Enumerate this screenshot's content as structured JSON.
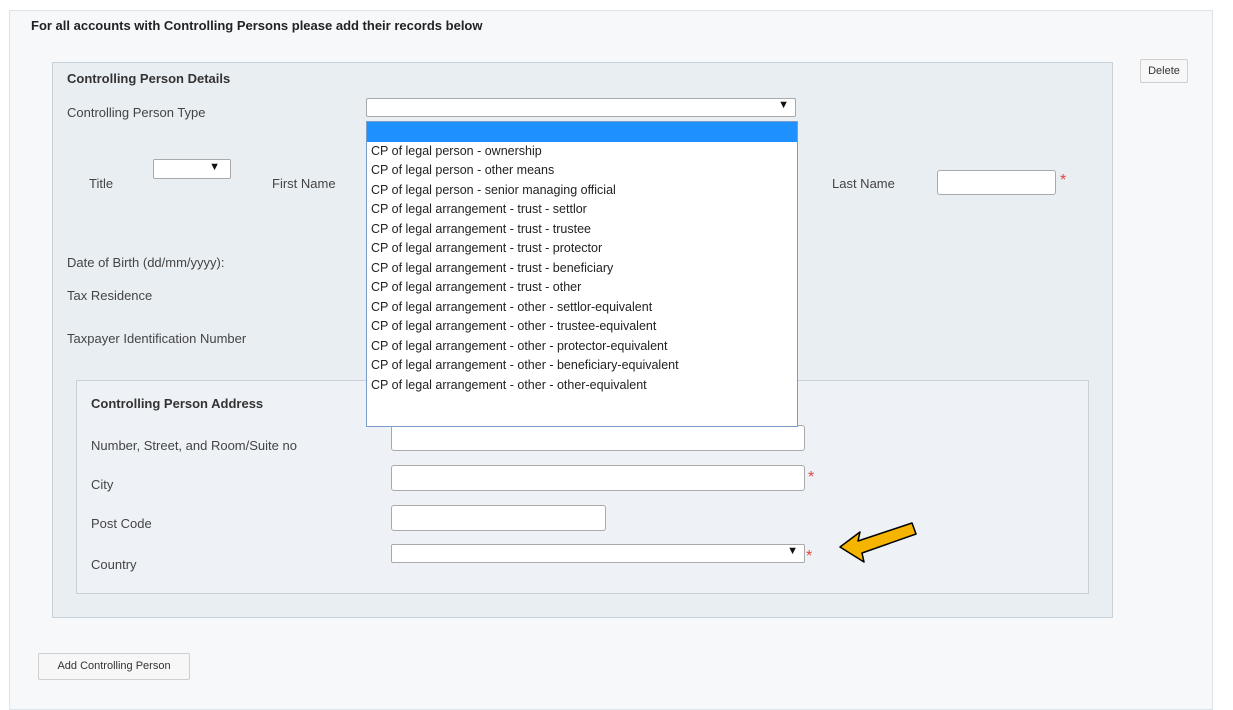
{
  "page": {
    "heading": "For all accounts with Controlling Persons please add their records below",
    "delete_label": "Delete",
    "add_label": "Add Controlling Person"
  },
  "details": {
    "section_title": "Controlling Person Details",
    "type_label": "Controlling Person Type",
    "type_value": "",
    "title_label": "Title",
    "first_name_label": "First Name",
    "last_name_label": "Last Name",
    "dob_label": "Date of Birth (dd/mm/yyyy):",
    "tax_residence_label": "Tax Residence",
    "tin_label": "Taxpayer Identification Number",
    "required_mark": "*"
  },
  "address": {
    "section_title": "Controlling Person Address",
    "street_label": "Number, Street, and Room/Suite no",
    "city_label": "City",
    "postcode_label": "Post Code",
    "country_label": "Country",
    "required_mark": "*"
  },
  "dropdown": {
    "options": [
      "",
      "CP of legal person - ownership",
      "CP of legal person - other means",
      "CP of legal person - senior managing official",
      "CP of legal arrangement - trust - settlor",
      "CP of legal arrangement - trust - trustee",
      "CP of legal arrangement - trust - protector",
      "CP of legal arrangement - trust - beneficiary",
      "CP of legal arrangement - trust - other",
      "CP of legal arrangement - other - settlor-equivalent",
      "CP of legal arrangement - other - trustee-equivalent",
      "CP of legal arrangement - other - protector-equivalent",
      "CP of legal arrangement - other - beneficiary-equivalent",
      "CP of legal arrangement - other - other-equivalent"
    ],
    "selected_index": 0
  },
  "icons": {
    "arrow": "▼",
    "pointer": "arrow-left-icon"
  },
  "colors": {
    "highlight": "#1e90ff",
    "required": "#e0473f",
    "pointer": "#f5b400"
  }
}
